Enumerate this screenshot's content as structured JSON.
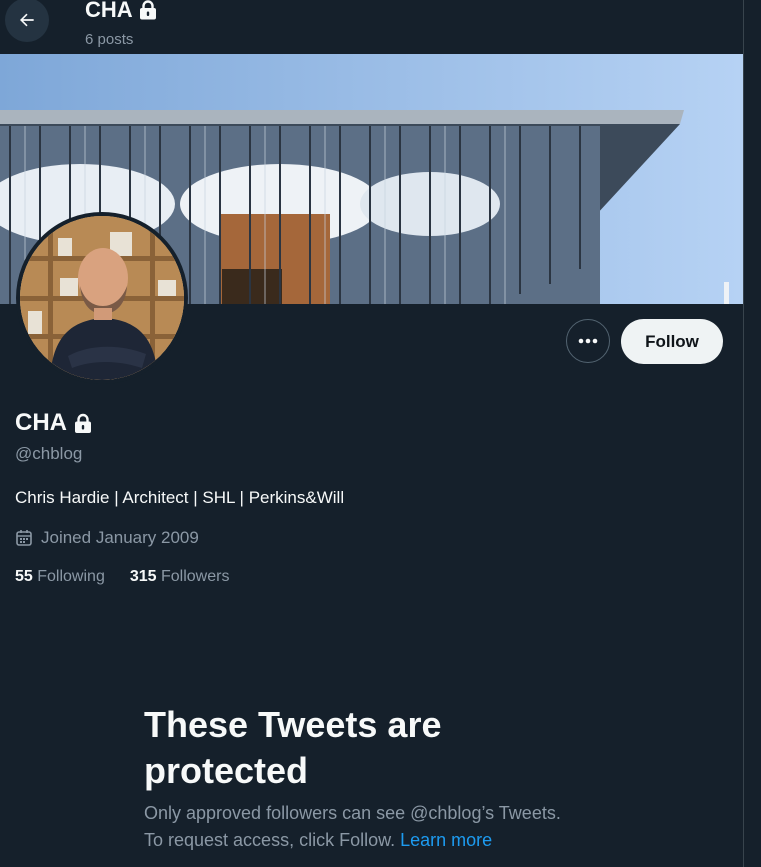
{
  "header": {
    "name": "CHA",
    "post_count": "6 posts"
  },
  "profile": {
    "display_name": "CHA",
    "handle": "@chblog",
    "bio": "Chris Hardie | Architect | SHL | Perkins&Will",
    "joined": "Joined January 2009",
    "following_count": "55",
    "following_label": "Following",
    "followers_count": "315",
    "followers_label": "Followers"
  },
  "actions": {
    "follow_label": "Follow"
  },
  "protected": {
    "title": "These Tweets are protected",
    "line1": "Only approved followers can see @chblog’s Tweets.",
    "line2": "To request access, click Follow.",
    "learn_more": "Learn more"
  },
  "colors": {
    "background": "#15202b",
    "accent": "#1d9bf0",
    "secondary_text": "#8b98a5"
  },
  "icons": [
    "back-arrow-icon",
    "lock-icon",
    "more-icon",
    "calendar-icon"
  ]
}
